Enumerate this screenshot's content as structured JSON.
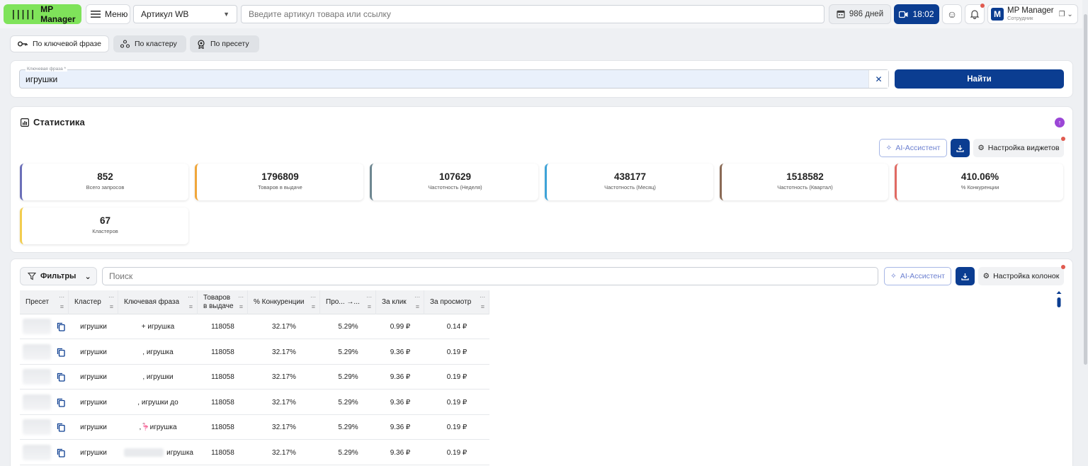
{
  "topbar": {
    "logo": "MP Manager",
    "menu_label": "Меню",
    "article_select": "Артикул WB",
    "search_placeholder": "Введите артикул товара или ссылку",
    "days_label": "986 дней",
    "time_label": "18:02",
    "user_name": "MP Manager",
    "user_role": "Сотрудник",
    "user_initial": "M"
  },
  "modes": {
    "by_phrase": "По ключевой фразе",
    "by_cluster": "По кластеру",
    "by_preset": "По пресету"
  },
  "keyword": {
    "label": "Ключевая фраза *",
    "value": "игрушки",
    "find_label": "Найти"
  },
  "stats": {
    "title": "Статистика",
    "ai_label": "AI-Ассистент",
    "settings_label": "Настройка виджетов",
    "tiles": [
      {
        "value": "852",
        "label": "Всего запросов",
        "color": "#6b6fb8"
      },
      {
        "value": "1796809",
        "label": "Товаров в выдаче",
        "color": "#f0a63a"
      },
      {
        "value": "107629",
        "label": "Частотность (Неделя)",
        "color": "#6e8791"
      },
      {
        "value": "438177",
        "label": "Частотность (Месяц)",
        "color": "#3ea3d8"
      },
      {
        "value": "1518582",
        "label": "Частотность (Квартал)",
        "color": "#8a6a55"
      },
      {
        "value": "410.06%",
        "label": "% Конкуренции",
        "color": "#e06a63"
      },
      {
        "value": "67",
        "label": "Кластеров",
        "color": "#f2cd4f"
      }
    ]
  },
  "table": {
    "filters_label": "Фильтры",
    "search_placeholder": "Поиск",
    "ai_label": "AI-Ассистент",
    "settings_label": "Настройка колонок",
    "columns": [
      "Пресет",
      "Кластер",
      "Ключевая фраза",
      "Товаров в выдаче",
      "% Конкуренции",
      "Про... →...",
      "За клик",
      "За просмотр"
    ],
    "rows": [
      {
        "cluster": "игрушки",
        "phrase": "+ игрушка",
        "goods": "118058",
        "competition": "32.17%",
        "pro": "5.29%",
        "click": "0.99 ₽",
        "view": "0.14 ₽"
      },
      {
        "cluster": "игрушки",
        "phrase": ", игрушка",
        "goods": "118058",
        "competition": "32.17%",
        "pro": "5.29%",
        "click": "9.36 ₽",
        "view": "0.19 ₽"
      },
      {
        "cluster": "игрушки",
        "phrase": ", игрушки",
        "goods": "118058",
        "competition": "32.17%",
        "pro": "5.29%",
        "click": "9.36 ₽",
        "view": "0.19 ₽"
      },
      {
        "cluster": "игрушки",
        "phrase": ", игрушки до",
        "goods": "118058",
        "competition": "32.17%",
        "pro": "5.29%",
        "click": "9.36 ₽",
        "view": "0.19 ₽"
      },
      {
        "cluster": "игрушки",
        "phrase": ",🦩игрушка",
        "goods": "118058",
        "competition": "32.17%",
        "pro": "5.29%",
        "click": "9.36 ₽",
        "view": "0.19 ₽"
      },
      {
        "cluster": "игрушки",
        "phrase": "игрушка",
        "goods": "118058",
        "competition": "32.17%",
        "pro": "5.29%",
        "click": "9.36 ₽",
        "view": "0.19 ₽"
      }
    ]
  }
}
